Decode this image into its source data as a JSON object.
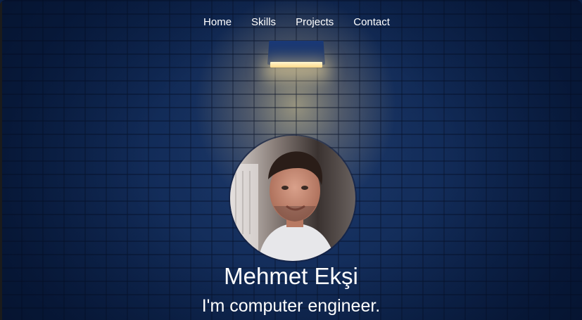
{
  "nav": {
    "items": [
      {
        "label": "Home"
      },
      {
        "label": "Skills"
      },
      {
        "label": "Projects"
      },
      {
        "label": "Contact"
      }
    ]
  },
  "hero": {
    "name": "Mehmet Ekşi",
    "tagline": "I'm computer engineer."
  },
  "colors": {
    "background": "#0a2047",
    "text": "#ffffff",
    "lamp_light": "#ffd98a"
  },
  "icons": {
    "lamp": "wall-lamp-icon",
    "profile": "profile-photo"
  }
}
